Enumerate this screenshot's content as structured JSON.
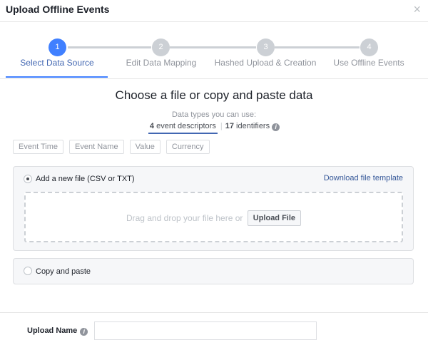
{
  "dialog": {
    "title": "Upload Offline Events",
    "close_glyph": "×"
  },
  "steps": [
    {
      "number": "1",
      "label": "Select Data Source",
      "active": true
    },
    {
      "number": "2",
      "label": "Edit Data Mapping",
      "active": false
    },
    {
      "number": "3",
      "label": "Hashed Upload & Creation",
      "active": false
    },
    {
      "number": "4",
      "label": "Use Offline Events",
      "active": false
    }
  ],
  "main": {
    "heading": "Choose a file or copy and paste data",
    "subheading": "Data types you can use:",
    "types": [
      {
        "count": "4",
        "label": "event descriptors"
      },
      {
        "count": "17",
        "label": "identifiers"
      }
    ],
    "separator": "|",
    "info_glyph": "i",
    "chips": [
      "Event Time",
      "Event Name",
      "Value",
      "Currency"
    ]
  },
  "upload_file_option": {
    "label": "Add a new file (CSV or TXT)",
    "template_link": "Download file template",
    "drop_text": "Drag and drop your file here or",
    "upload_button": "Upload File"
  },
  "paste_option": {
    "label": "Copy and paste"
  },
  "footer": {
    "upload_name_label": "Upload Name",
    "upload_name_value": "",
    "upload_name_placeholder": ""
  },
  "colors": {
    "accent": "#4080ff",
    "link": "#365899",
    "inactive": "#ccd0d5"
  }
}
